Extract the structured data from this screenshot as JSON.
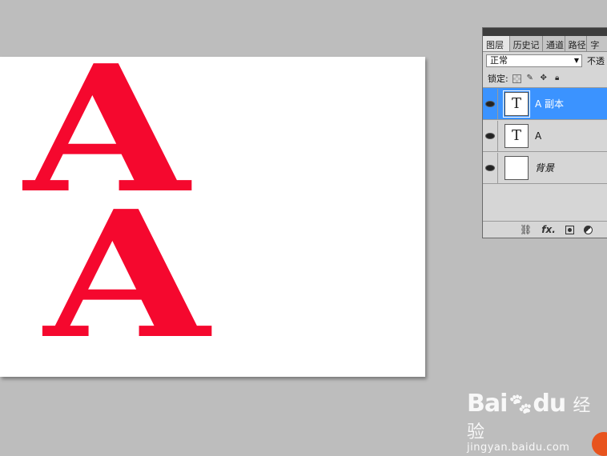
{
  "canvas": {
    "glyph_top": "A",
    "glyph_bottom": "A",
    "glyph_color": "#f5082e"
  },
  "layers_panel": {
    "tabs": [
      "图层",
      "历史记",
      "通道",
      "路径",
      "字"
    ],
    "blend_mode": "正常",
    "opacity_label": "不透",
    "lock_label": "锁定:",
    "layers": [
      {
        "name": "A 副本",
        "thumb": "T",
        "selected": true
      },
      {
        "name": "A",
        "thumb": "T",
        "selected": false
      },
      {
        "name": "背景",
        "thumb": "",
        "selected": false
      }
    ],
    "footer": {
      "link_icon": "link-icon",
      "fx": "fx.",
      "mask_icon": "mask-icon",
      "adjust_icon": "adjustment-icon"
    }
  },
  "watermark": {
    "logo": "Bai",
    "logo_suffix": "du",
    "cn": "经验",
    "url": "jingyan.baidu.com"
  },
  "colors": {
    "selection": "#3b93ff",
    "workspace": "#bdbdbd"
  }
}
